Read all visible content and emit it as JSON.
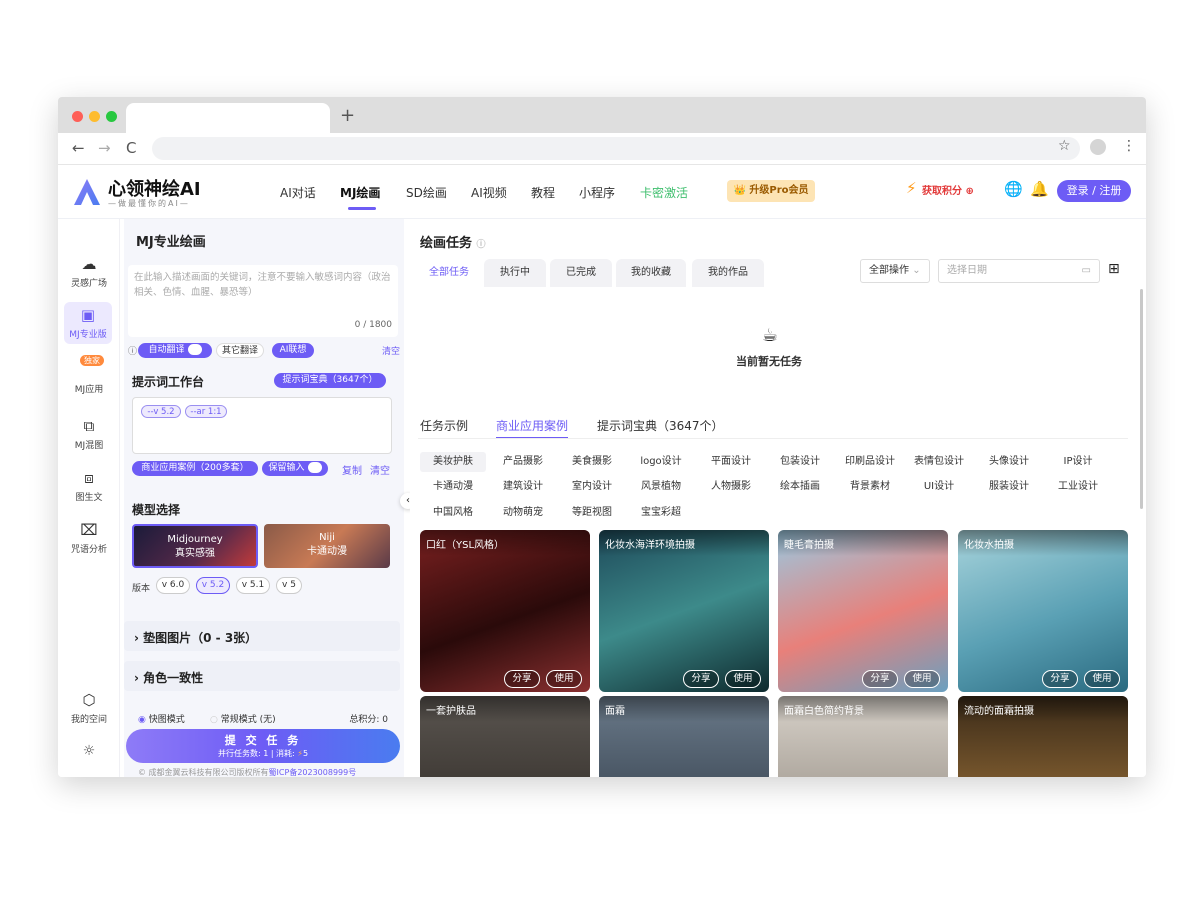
{
  "browser": {
    "new_tab": "+",
    "back": "←",
    "forward": "→",
    "reload": "C",
    "star": "☆",
    "more": "⋮"
  },
  "brand": {
    "name": "心领神绘AI",
    "slogan": "—做最懂你的AI—",
    "accent": "#6d5cf5"
  },
  "topnav": {
    "items": [
      "AI对话",
      "MJ绘画",
      "SD绘画",
      "AI视频",
      "教程",
      "小程序",
      "卡密激活"
    ],
    "active": "MJ绘画",
    "pro_label": "升级Pro会员",
    "points_label": "获取积分",
    "login_label": "登录 / 注册"
  },
  "sidebar": {
    "items": [
      {
        "label": "灵感广场",
        "icon": "cloud-icon"
      },
      {
        "label": "MJ专业版",
        "icon": "palette-icon"
      },
      {
        "label": "MJ应用",
        "icon": "app-icon",
        "badge": "独家"
      },
      {
        "label": "MJ混图",
        "icon": "blend-icon"
      },
      {
        "label": "图生文",
        "icon": "image-text-icon"
      },
      {
        "label": "咒语分析",
        "icon": "analyze-icon"
      },
      {
        "label": "我的空间",
        "icon": "cube-icon"
      }
    ],
    "theme_icon": "☼"
  },
  "panel": {
    "title": "MJ专业绘画",
    "prompt_placeholder": "在此输入描述画面的关键词，注意不要输入敏感词内容（政治相关、色情、血腥、暴恐等）",
    "prompt_count": "0 / 1800",
    "auto_translate": "自动翻译",
    "other_translate": "其它翻译",
    "ai_assoc": "AI联想",
    "clear": "清空",
    "workbench_title": "提示词工作台",
    "dict_btn": "提示词宝典（3647个）",
    "chips": [
      "--v 5.2",
      "--ar 1:1"
    ],
    "biz_cases": "商业应用案例（200多套）",
    "keep_input": "保留输入",
    "copy": "复制",
    "clear2": "清空",
    "model_title": "模型选择",
    "models": [
      {
        "name": "Midjourney",
        "sub": "真实感强"
      },
      {
        "name": "Niji",
        "sub": "卡通动漫"
      }
    ],
    "version_label": "版本",
    "versions": [
      "v 6.0",
      "v 5.2",
      "v 5.1",
      "v 5"
    ],
    "version_selected": "v 5.2",
    "pad_images": "垫图图片（0 - 3张）",
    "role_consistency": "角色一致性",
    "fast_mode": "快图模式",
    "normal_mode": "常规模式 (无)",
    "total_points": "总积分: 0",
    "submit": "提 交 任 务",
    "submit_sub": "并行任务数: 1 | 消耗:",
    "submit_cost": "5",
    "footer": "成都金翼云科技有限公司版权所有",
    "icp": "蜀ICP备2023008999号"
  },
  "main": {
    "title": "绘画任务",
    "tabs": [
      "全部任务",
      "执行中",
      "已完成",
      "我的收藏",
      "我的作品"
    ],
    "active_tab": "全部任务",
    "ops_select": "全部操作",
    "date_placeholder": "选择日期",
    "empty_text": "当前暂无任务",
    "section_tabs": [
      "任务示例",
      "商业应用案例",
      "提示词宝典（3647个）"
    ],
    "active_section": "商业应用案例",
    "categories": [
      "美妆护肤",
      "产品摄影",
      "美食摄影",
      "logo设计",
      "平面设计",
      "包装设计",
      "印刷品设计",
      "表情包设计",
      "头像设计",
      "IP设计",
      "卡通动漫",
      "建筑设计",
      "室内设计",
      "风景植物",
      "人物摄影",
      "绘本插画",
      "背景素材",
      "UI设计",
      "服装设计",
      "工业设计",
      "中国风格",
      "动物萌宠",
      "等距视图",
      "宝宝彩超"
    ],
    "active_category": "美妆护肤",
    "share": "分享",
    "use": "使用",
    "cards": [
      {
        "title": "口红（YSL风格）",
        "bg": "#5a1a1a"
      },
      {
        "title": "化妆水海洋环境拍摄",
        "bg": "#2e6a6a"
      },
      {
        "title": "睫毛膏拍摄",
        "bg": "#6aa6c8"
      },
      {
        "title": "化妆水拍摄",
        "bg": "#7bb8c4"
      },
      {
        "title": "一套护肤品",
        "bg": "#3a3530"
      },
      {
        "title": "面霜",
        "bg": "#3a4a5a"
      },
      {
        "title": "面霜白色简约背景",
        "bg": "#a8a29a"
      },
      {
        "title": "流动的面霜拍摄",
        "bg": "#5a4020"
      }
    ]
  }
}
